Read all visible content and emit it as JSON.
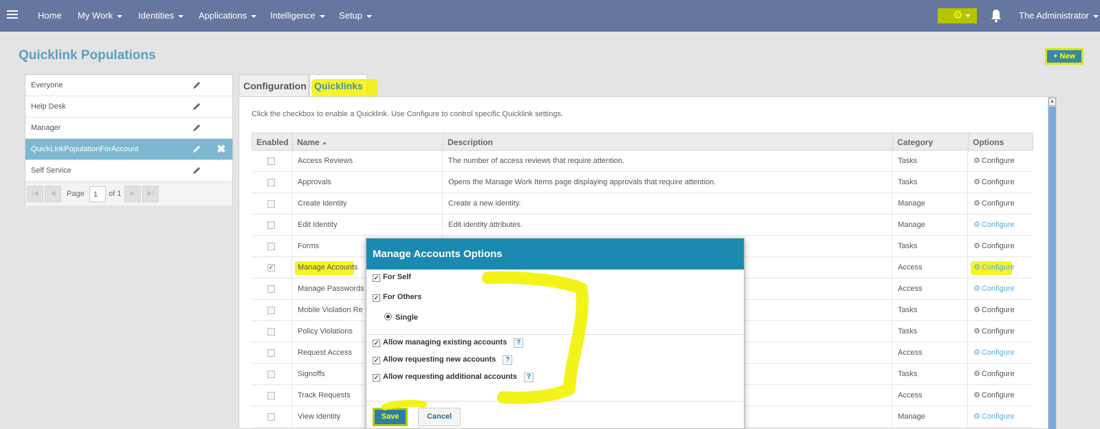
{
  "nav": {
    "items": [
      "Home",
      "My Work",
      "Identities",
      "Applications",
      "Intelligence",
      "Setup"
    ],
    "user": "The Administrator"
  },
  "page": {
    "title": "Quicklink Populations",
    "new_label": "New"
  },
  "populations": [
    "Everyone",
    "Help Desk",
    "Manager",
    "QuickLinkPopulationForAccount",
    "Self Service"
  ],
  "pager": {
    "page_label": "Page",
    "page_value": "1",
    "of_label": "of 1"
  },
  "tabs": [
    "Configuration",
    "Quicklinks"
  ],
  "instructions": "Click the checkbox to enable a Quicklink. Use Configure to control specific Quicklink settings.",
  "grid": {
    "headers": [
      "Enabled",
      "Name",
      "Description",
      "Category",
      "Options"
    ],
    "configure_label": "Configure",
    "rows": [
      {
        "name": "Access Reviews",
        "description": "The number of access reviews that require attention.",
        "category": "Tasks",
        "enabled": "",
        "link": false
      },
      {
        "name": "Approvals",
        "description": "Opens the Manage Work Items page displaying approvals that require attention.",
        "category": "Tasks",
        "enabled": "",
        "link": false
      },
      {
        "name": "Create Identity",
        "description": "Create a new identity.",
        "category": "Manage",
        "enabled": "",
        "link": false
      },
      {
        "name": "Edit Identity",
        "description": "Edit identity attributes.",
        "category": "Manage",
        "enabled": "",
        "link": true
      },
      {
        "name": "Forms",
        "description": "",
        "category": "Tasks",
        "enabled": "",
        "link": false
      },
      {
        "name": "Manage Accounts",
        "description": "",
        "category": "Access",
        "enabled": "✓",
        "link": true
      },
      {
        "name": "Manage Passwords",
        "description": "",
        "category": "Access",
        "enabled": "",
        "link": true
      },
      {
        "name": "Mobile Violation Re",
        "description": "",
        "category": "Tasks",
        "enabled": "",
        "link": false
      },
      {
        "name": "Policy Violations",
        "description": "",
        "category": "Tasks",
        "enabled": "",
        "link": false
      },
      {
        "name": "Request Access",
        "description": "",
        "category": "Access",
        "enabled": "",
        "link": true
      },
      {
        "name": "Signoffs",
        "description": "",
        "category": "Tasks",
        "enabled": "",
        "link": false
      },
      {
        "name": "Track Requests",
        "description": "",
        "category": "Access",
        "enabled": "",
        "link": false
      },
      {
        "name": "View Identity",
        "description": "",
        "category": "Manage",
        "enabled": "",
        "link": true
      }
    ]
  },
  "modal": {
    "title": "Manage Accounts Options",
    "for_self": "For Self",
    "for_others": "For Others",
    "single": "Single",
    "allow_existing": "Allow managing existing accounts",
    "allow_new": "Allow requesting new accounts",
    "allow_additional": "Allow requesting additional accounts",
    "help": "?",
    "check": "✓",
    "save": "Save",
    "cancel": "Cancel"
  },
  "colors": {
    "nav": "#65779e",
    "accent": "#1b8ab0",
    "highlight": "#f2f200"
  }
}
